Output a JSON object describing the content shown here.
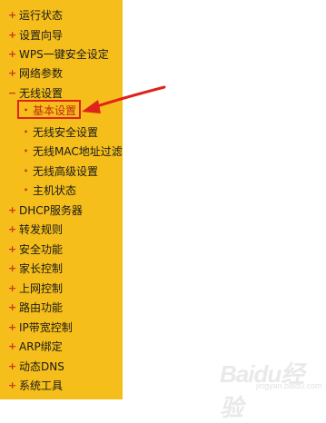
{
  "sidebar": {
    "items": [
      {
        "label": "运行状态",
        "marker": "+"
      },
      {
        "label": "设置向导",
        "marker": "+"
      },
      {
        "label": "WPS一键安全设定",
        "marker": "+"
      },
      {
        "label": "网络参数",
        "marker": "+"
      },
      {
        "label": "无线设置",
        "marker": "−"
      },
      {
        "label": "基本设置",
        "marker": "•"
      },
      {
        "label": "无线安全设置",
        "marker": "•"
      },
      {
        "label": "无线MAC地址过滤",
        "marker": "•"
      },
      {
        "label": "无线高级设置",
        "marker": "•"
      },
      {
        "label": "主机状态",
        "marker": "•"
      },
      {
        "label": "DHCP服务器",
        "marker": "+"
      },
      {
        "label": "转发规则",
        "marker": "+"
      },
      {
        "label": "安全功能",
        "marker": "+"
      },
      {
        "label": "家长控制",
        "marker": "+"
      },
      {
        "label": "上网控制",
        "marker": "+"
      },
      {
        "label": "路由功能",
        "marker": "+"
      },
      {
        "label": "IP带宽控制",
        "marker": "+"
      },
      {
        "label": "ARP绑定",
        "marker": "+"
      },
      {
        "label": "动态DNS",
        "marker": "+"
      },
      {
        "label": "系统工具",
        "marker": "+"
      }
    ],
    "active_item": "基本设置"
  },
  "watermark": {
    "brand": "Baidu经验",
    "url": "jingyan.baidu.com"
  },
  "colors": {
    "sidebar_bg": "#f5be1a",
    "marker": "#c8391a",
    "highlight": "#e0231a"
  }
}
